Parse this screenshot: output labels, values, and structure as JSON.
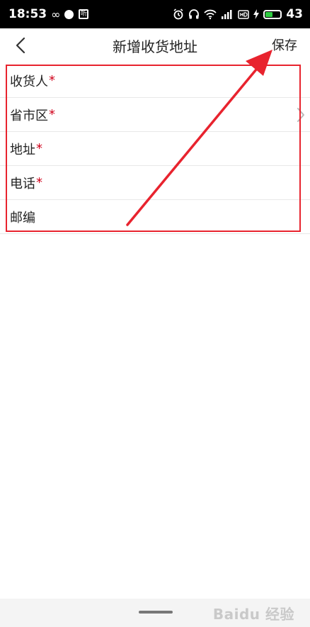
{
  "status_bar": {
    "time": "18:53",
    "infinity_glyph": "∞",
    "app_badge": "听",
    "battery_level": "43",
    "icons": [
      "alarm-icon",
      "headphones-icon",
      "wifi-icon",
      "signal-icon",
      "hd-icon",
      "charging-icon",
      "battery-icon"
    ]
  },
  "nav": {
    "title": "新增收货地址",
    "save_label": "保存",
    "back_icon": "chevron-left-icon"
  },
  "form": {
    "rows": [
      {
        "label": "收货人",
        "required": "*"
      },
      {
        "label": "省市区",
        "required": "*",
        "has_arrow": true
      },
      {
        "label": "地址",
        "required": "*"
      },
      {
        "label": "电话",
        "required": "*"
      },
      {
        "label": "邮编"
      }
    ]
  },
  "watermark": "Baidu 经验",
  "colors": {
    "required": "#d0021b",
    "annotation": "#e8232e",
    "status_bar_bg": "#000000",
    "battery_fill": "#2ecc40"
  }
}
